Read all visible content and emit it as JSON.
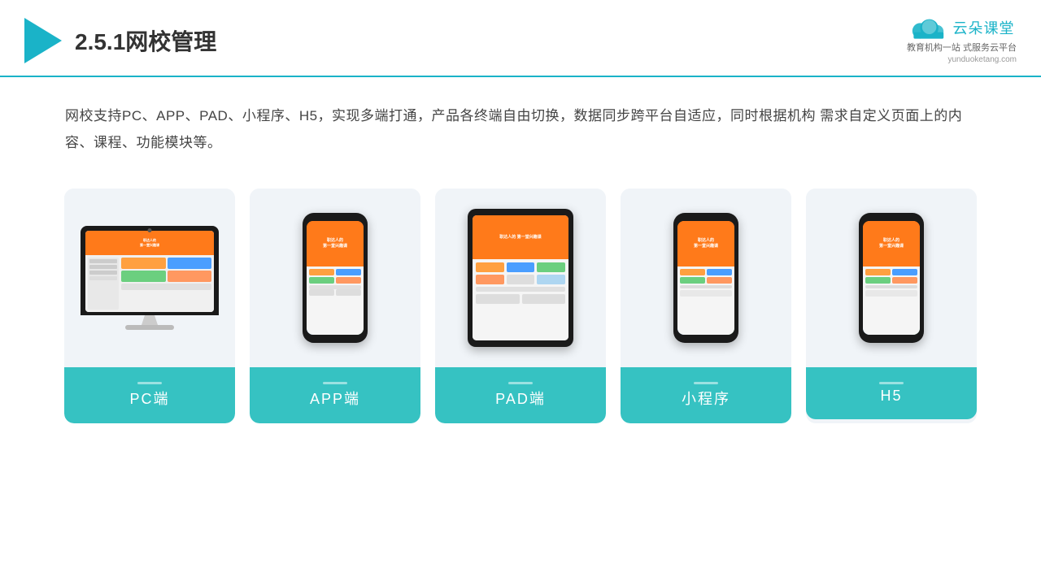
{
  "header": {
    "title": "2.5.1网校管理",
    "brand_name": "云朵课堂",
    "brand_url": "yunduoketang.com",
    "brand_tagline": "教育机构一站\n式服务云平台"
  },
  "description": "网校支持PC、APP、PAD、小程序、H5，实现多端打通，产品各终端自由切换，数据同步跨平台自适应，同时根据机构\n需求自定义页面上的内容、课程、功能模块等。",
  "cards": [
    {
      "id": "pc",
      "label": "PC端"
    },
    {
      "id": "app",
      "label": "APP端"
    },
    {
      "id": "pad",
      "label": "PAD端"
    },
    {
      "id": "miniprogram",
      "label": "小程序"
    },
    {
      "id": "h5",
      "label": "H5"
    }
  ],
  "colors": {
    "accent": "#1ab3c8",
    "card_label_bg": "#36c2c2",
    "orange": "#ff7a1a"
  }
}
